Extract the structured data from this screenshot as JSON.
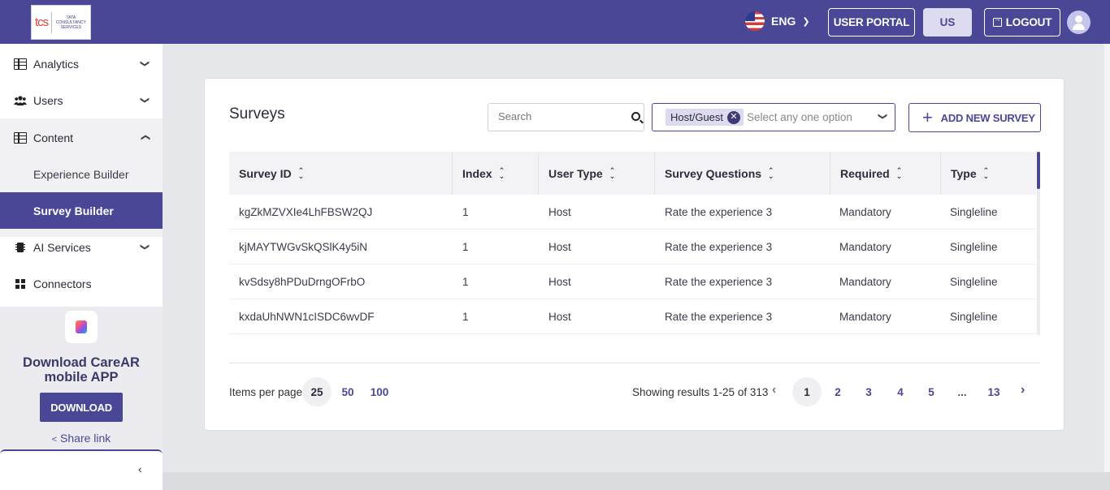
{
  "header": {
    "logo_text": "tcs",
    "logo_subtext": "TATA CONSULTANCY SERVICES",
    "language": "ENG",
    "user_portal_label": "USER PORTAL",
    "region_label": "US",
    "logout_label": "LOGOUT",
    "brand_color": "#4a4796"
  },
  "sidebar": {
    "items": [
      {
        "label": "Analytics",
        "icon": "table-icon"
      },
      {
        "label": "Users",
        "icon": "users-icon"
      },
      {
        "label": "Content",
        "icon": "table-icon"
      },
      {
        "label": "Experience Builder"
      },
      {
        "label": "Survey Builder",
        "active": true
      },
      {
        "label": "AI Services",
        "icon": "chip-icon"
      },
      {
        "label": "Connectors",
        "icon": "grid-icon"
      }
    ],
    "promo": {
      "title": "Download CareAR mobile APP",
      "download_label": "DOWNLOAD",
      "share_label": "Share link"
    }
  },
  "main": {
    "title": "Surveys",
    "search_placeholder": "Search",
    "filter_chip": "Host/Guest",
    "filter_placeholder": "Select any one option",
    "add_button_label": "ADD NEW SURVEY",
    "table": {
      "columns": [
        "Survey ID",
        "Index",
        "User Type",
        "Survey Questions",
        "Required",
        "Type"
      ],
      "rows": [
        [
          "kgZkMZVXIe4LhFBSW2QJ",
          "1",
          "Host",
          "Rate the experience 3",
          "Mandatory",
          "Singleline"
        ],
        [
          "kjMAYTWGvSkQSlK4y5iN",
          "1",
          "Host",
          "Rate the experience 3",
          "Mandatory",
          "Singleline"
        ],
        [
          "kvSdsy8hPDuDrngOFrbO",
          "1",
          "Host",
          "Rate the experience 3",
          "Mandatory",
          "Singleline"
        ],
        [
          "kxdaUhNWN1cISDC6wvDF",
          "1",
          "Host",
          "Rate the experience 3",
          "Mandatory",
          "Singleline"
        ]
      ]
    },
    "pagination": {
      "items_per_page_label": "Items per page:",
      "items_per_page_options": [
        "25",
        "50",
        "100"
      ],
      "selected_items_per_page": "25",
      "showing_text": "Showing results 1-25 of 313",
      "pages": [
        "1",
        "2",
        "3",
        "4",
        "5",
        "...",
        "13"
      ],
      "current_page": "1"
    }
  }
}
